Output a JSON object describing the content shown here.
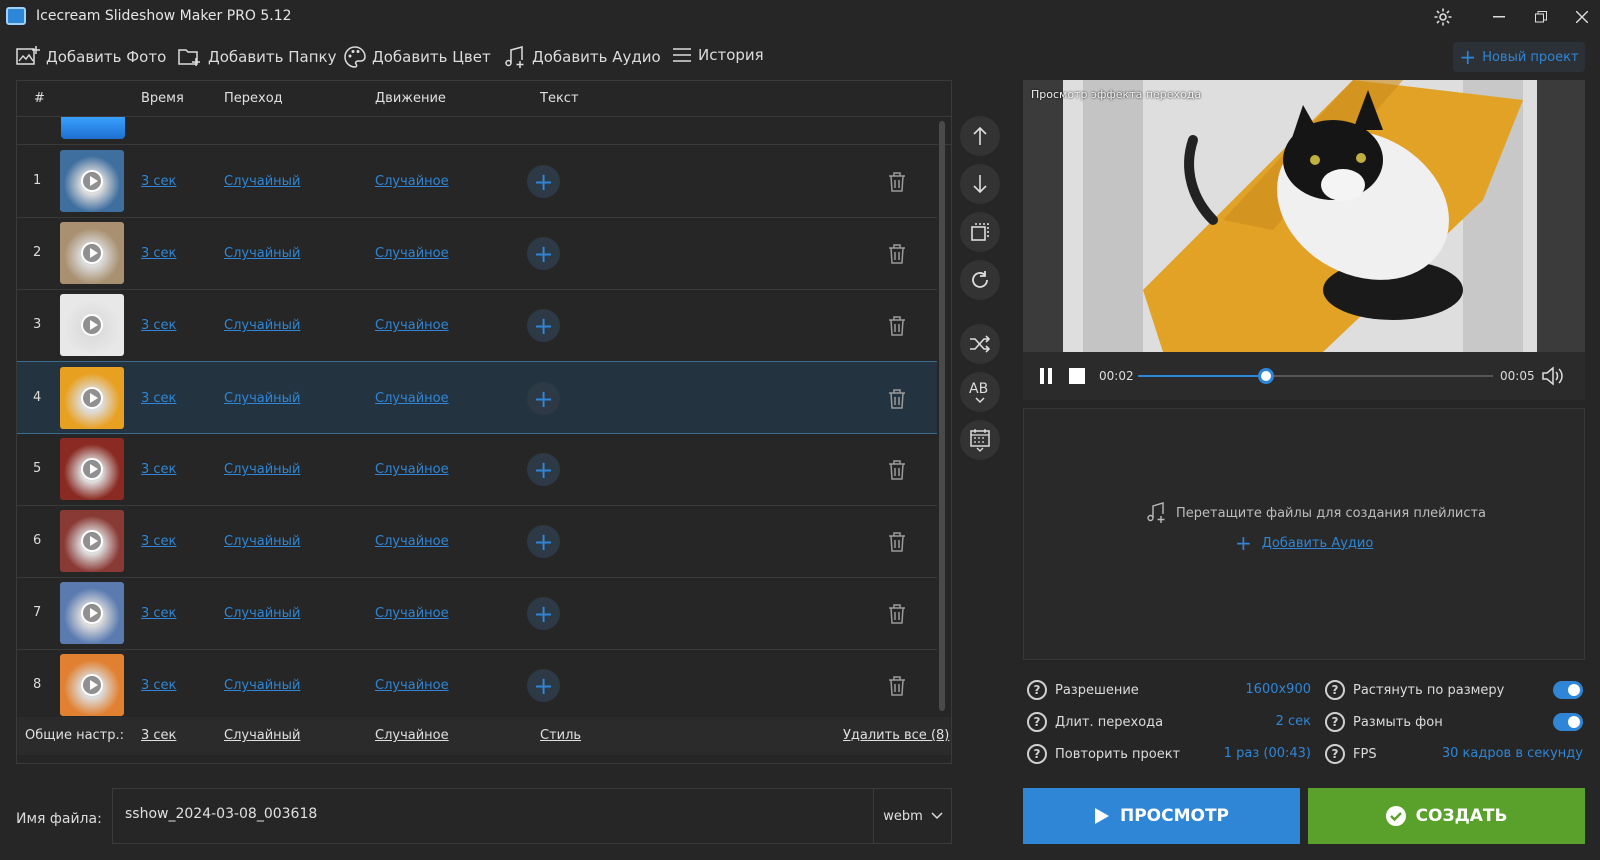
{
  "window": {
    "title": "Icecream Slideshow Maker PRO 5.12"
  },
  "toolbar": {
    "add_photo": "Добавить Фото",
    "add_folder": "Добавить Папку",
    "add_color": "Добавить Цвет",
    "add_audio": "Добавить Аудио",
    "history": "История",
    "new_project": "Новый проект"
  },
  "grid": {
    "headers": {
      "num": "#",
      "time": "Время",
      "transition": "Переход",
      "motion": "Движение",
      "text": "Текст"
    },
    "rows": [
      {
        "num": "1",
        "time": "3 сек",
        "transition": "Случайный",
        "motion": "Случайное",
        "thumb_color": "#3f6f9f"
      },
      {
        "num": "2",
        "time": "3 сек",
        "transition": "Случайный",
        "motion": "Случайное",
        "thumb_color": "#a89070"
      },
      {
        "num": "3",
        "time": "3 сек",
        "transition": "Случайный",
        "motion": "Случайное",
        "thumb_color": "#e8e8e8"
      },
      {
        "num": "4",
        "time": "3 сек",
        "transition": "Случайный",
        "motion": "Случайное",
        "thumb_color": "#e8a020"
      },
      {
        "num": "5",
        "time": "3 сек",
        "transition": "Случайный",
        "motion": "Случайное",
        "thumb_color": "#8a2a22"
      },
      {
        "num": "6",
        "time": "3 сек",
        "transition": "Случайный",
        "motion": "Случайное",
        "thumb_color": "#8a3a35"
      },
      {
        "num": "7",
        "time": "3 сек",
        "transition": "Случайный",
        "motion": "Случайное",
        "thumb_color": "#5a7ab0"
      },
      {
        "num": "8",
        "time": "3 сек",
        "transition": "Случайный",
        "motion": "Случайное",
        "thumb_color": "#e08030"
      }
    ],
    "selected_row": "4",
    "footer": {
      "label": "Общие настр.:",
      "time": "3 сек",
      "transition": "Случайный",
      "motion": "Случайное",
      "style": "Стиль",
      "delete_all": "Удалить все (8)"
    }
  },
  "file": {
    "label": "Имя файла:",
    "value": "sshow_2024-03-08_003618",
    "format": "webm"
  },
  "preview": {
    "label": "Просмотр эффекта перехода",
    "current_time": "00:02",
    "total_time": "00:05",
    "progress": 0.36
  },
  "audio_drop": {
    "hint": "Перетащите файлы для создания плейлиста",
    "add_audio": "Добавить Аудио"
  },
  "settings": {
    "resolution_label": "Разрешение",
    "resolution_value": "1600x900",
    "transition_len_label": "Длит. перехода",
    "transition_len_value": "2 сек",
    "repeat_label": "Повторить проект",
    "repeat_value": "1 раз (00:43)",
    "stretch_label": "Растянуть по размеру",
    "stretch_on": true,
    "blur_label": "Размыть фон",
    "blur_on": true,
    "fps_label": "FPS",
    "fps_value": "30 кадров в секунду",
    "help_glyph": "?"
  },
  "actions": {
    "preview": "ПРОСМОТР",
    "create": "СОЗДАТЬ"
  },
  "colors": {
    "accent": "#2f86d6",
    "create": "#5aa12b",
    "selected_row": "#243340",
    "background": "#262626"
  }
}
